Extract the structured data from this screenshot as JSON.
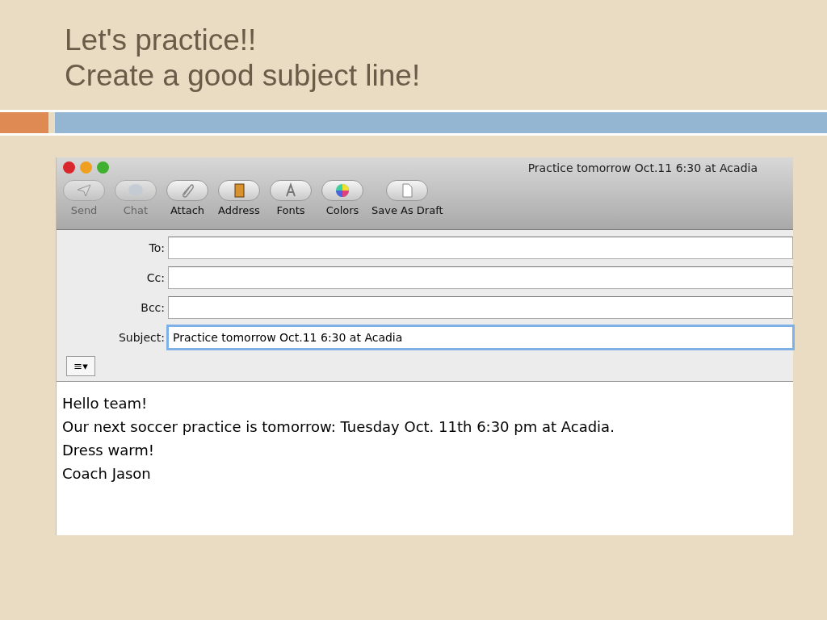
{
  "slide": {
    "title_lines": [
      "Let's practice!!",
      "Create a good subject line!"
    ]
  },
  "window": {
    "title": "Practice tomorrow Oct.11 6:30 at Acadia"
  },
  "toolbar": [
    {
      "kind": "send",
      "label": "Send",
      "disabled": true
    },
    {
      "kind": "chat",
      "label": "Chat",
      "disabled": true
    },
    {
      "kind": "attach",
      "label": "Attach",
      "disabled": false
    },
    {
      "kind": "address",
      "label": "Address",
      "disabled": false
    },
    {
      "kind": "fonts",
      "label": "Fonts",
      "disabled": false
    },
    {
      "kind": "colors",
      "label": "Colors",
      "disabled": false
    },
    {
      "kind": "draft",
      "label": "Save As Draft",
      "disabled": false
    }
  ],
  "fields": [
    {
      "label": "To:",
      "focused": false
    },
    {
      "label": "Cc:",
      "focused": false
    },
    {
      "label": "Bcc:",
      "focused": false
    },
    {
      "label": "Subject:",
      "value": "Practice tomorrow Oct.11 6:30 at Acadia",
      "focused": true
    }
  ],
  "format_menu": {
    "label": "≡▾"
  },
  "body": [
    "Hello team!",
    "Our next soccer practice is tomorrow: Tuesday Oct. 11th 6:30 pm at Acadia.",
    "Dress warm!",
    "Coach Jason"
  ]
}
